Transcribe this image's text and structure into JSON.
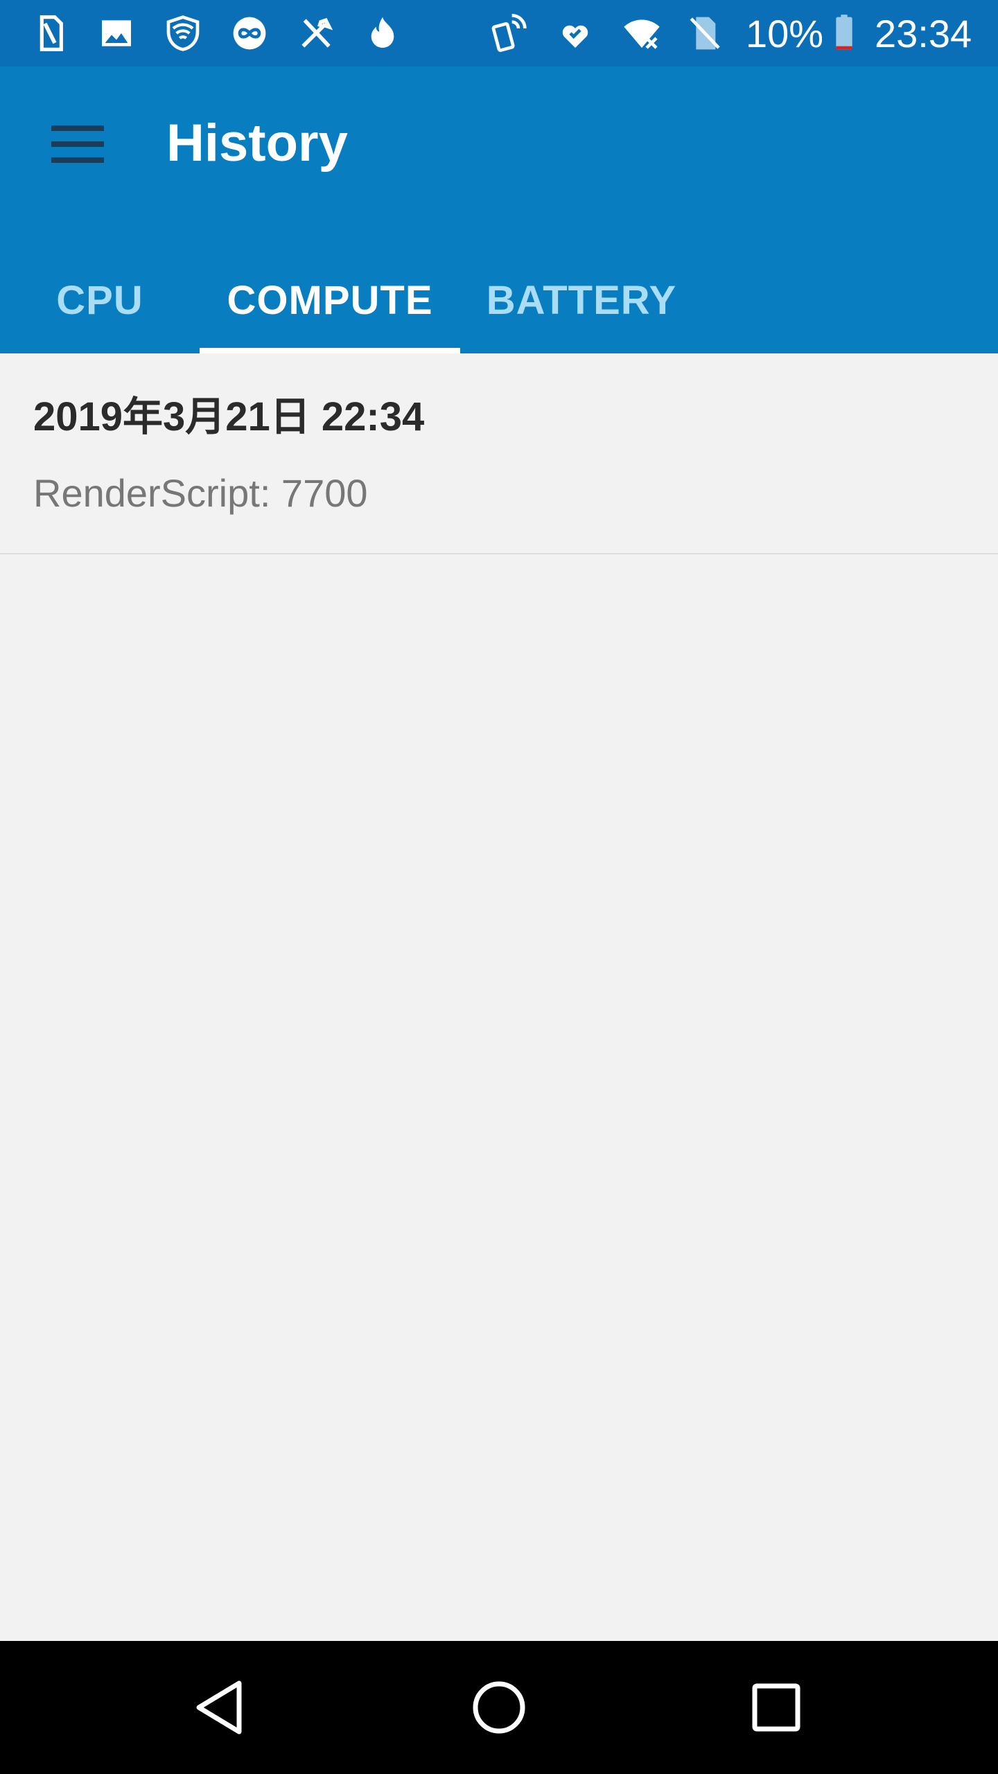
{
  "status_bar": {
    "icons_left": [
      "sim-card-icon",
      "image-icon",
      "vpn-shield-icon",
      "infinity-icon",
      "tools-icon",
      "flame-icon"
    ],
    "icons_right": [
      "nfc-phone-icon",
      "heart-shield-icon",
      "wifi-x-icon",
      "no-sim-icon"
    ],
    "battery_percent": "10%",
    "time": "23:34",
    "battery_level": 0.1,
    "battery_low_color": "#e0201b"
  },
  "toolbar": {
    "title": "History",
    "menu_icon": "hamburger-menu-icon",
    "background_color": "#087ec1"
  },
  "tabs": [
    {
      "label": "CPU",
      "selected": false
    },
    {
      "label": "COMPUTE",
      "selected": true
    },
    {
      "label": "BATTERY",
      "selected": false
    }
  ],
  "history": {
    "items": [
      {
        "date": "2019年3月21日 22:34",
        "score": "RenderScript: 7700"
      }
    ]
  },
  "nav_bar": {
    "icons": [
      "back-icon",
      "home-icon",
      "recents-icon"
    ]
  }
}
